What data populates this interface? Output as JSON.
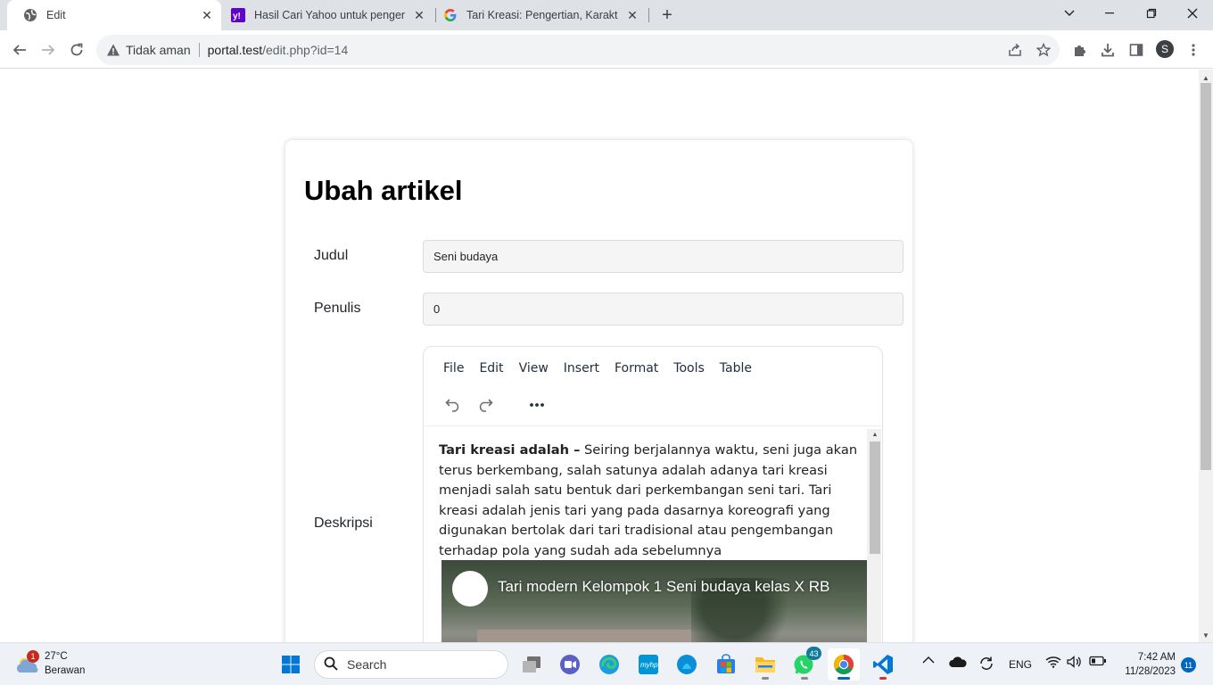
{
  "browser": {
    "tabs": [
      {
        "title": "Edit",
        "icon": "globe-icon",
        "active": true
      },
      {
        "title": "Hasil Cari Yahoo untuk pengertian",
        "icon": "yahoo-icon",
        "active": false
      },
      {
        "title": "Tari Kreasi: Pengertian, Karakteristik",
        "icon": "google-icon",
        "active": false
      }
    ],
    "new_tab": "+",
    "security_status": "Tidak aman",
    "url_host": "portal.test",
    "url_path": "/edit.php?id=14",
    "profile_initial": "S"
  },
  "page": {
    "heading": "Ubah artikel",
    "fields": {
      "judul_label": "Judul",
      "judul_value": "Seni budaya",
      "penulis_label": "Penulis",
      "penulis_value": "0",
      "deskripsi_label": "Deskripsi"
    },
    "editor": {
      "menu": [
        "File",
        "Edit",
        "View",
        "Insert",
        "Format",
        "Tools",
        "Table"
      ],
      "content_bold": "Tari kreasi adalah –",
      "content_text": " Seiring berjalannya waktu, seni juga akan terus berkembang, salah satunya adalah adanya tari kreasi menjadi salah satu bentuk dari perkembangan seni tari. Tari kreasi adalah jenis tari yang pada dasarnya koreografi yang digunakan bertolak dari tari tradisional atau pengembangan terhadap pola yang sudah ada sebelumnya",
      "video_title": "Tari modern Kelompok 1 Seni budaya kelas X RB"
    }
  },
  "taskbar": {
    "weather_temp": "27°C",
    "weather_cond": "Berawan",
    "weather_badge": "1",
    "search_placeholder": "Search",
    "whatsapp_badge": "43",
    "language": "ENG",
    "time": "7:42 AM",
    "date": "11/28/2023",
    "notifications": "11"
  },
  "colors": {
    "tabstrip": "#dee1e6",
    "accent": "#0067c0",
    "badge_red": "#c42b1c"
  }
}
